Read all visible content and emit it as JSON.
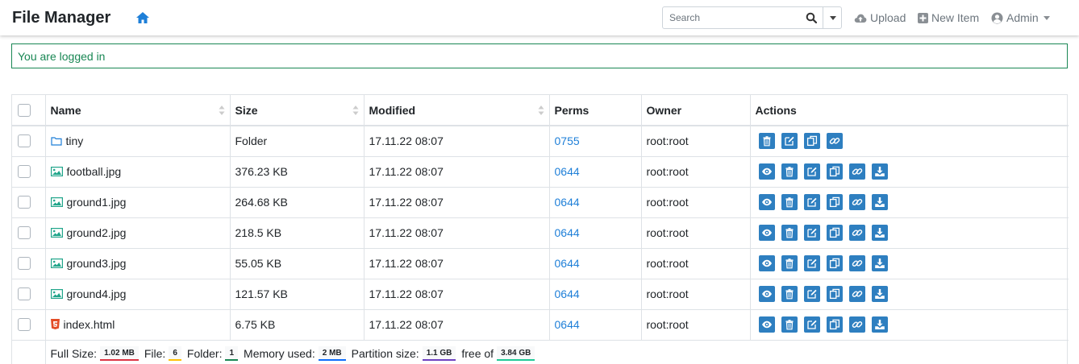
{
  "header": {
    "title": "File Manager",
    "search_placeholder": "Search",
    "upload_label": "Upload",
    "new_item_label": "New Item",
    "user_label": "Admin"
  },
  "alert": {
    "message": "You are logged in"
  },
  "table": {
    "columns": [
      "Name",
      "Size",
      "Modified",
      "Perms",
      "Owner",
      "Actions"
    ],
    "rows": [
      {
        "name": "tiny",
        "size": "Folder",
        "modified": "17.11.22 08:07",
        "perms": "0755",
        "owner": "root:root",
        "type": "folder"
      },
      {
        "name": "football.jpg",
        "size": "376.23 KB",
        "modified": "17.11.22 08:07",
        "perms": "0644",
        "owner": "root:root",
        "type": "image"
      },
      {
        "name": "ground1.jpg",
        "size": "264.68 KB",
        "modified": "17.11.22 08:07",
        "perms": "0644",
        "owner": "root:root",
        "type": "image"
      },
      {
        "name": "ground2.jpg",
        "size": "218.5 KB",
        "modified": "17.11.22 08:07",
        "perms": "0644",
        "owner": "root:root",
        "type": "image"
      },
      {
        "name": "ground3.jpg",
        "size": "55.05 KB",
        "modified": "17.11.22 08:07",
        "perms": "0644",
        "owner": "root:root",
        "type": "image"
      },
      {
        "name": "ground4.jpg",
        "size": "121.57 KB",
        "modified": "17.11.22 08:07",
        "perms": "0644",
        "owner": "root:root",
        "type": "image"
      },
      {
        "name": "index.html",
        "size": "6.75 KB",
        "modified": "17.11.22 08:07",
        "perms": "0644",
        "owner": "root:root",
        "type": "html"
      }
    ]
  },
  "footer": {
    "full_size_label": "Full Size:",
    "full_size_value": "1.02 MB",
    "file_label": "File:",
    "file_value": "6",
    "folder_label": "Folder:",
    "folder_value": "1",
    "memory_label": "Memory used:",
    "memory_value": "2 MB",
    "partition_label": "Partition size:",
    "partition_value": "1.1 GB",
    "free_label": "free of",
    "free_value": "3.84 GB"
  },
  "colors": {
    "accent": "#1e7fd8",
    "action_button": "#2e7fc0",
    "alert_green": "#198754",
    "image_icon": "#20a58a",
    "html_icon": "#e34c26",
    "badge_full_size": "#dc3545",
    "badge_file": "#ffc107",
    "badge_folder": "#198754",
    "badge_memory": "#0d6efd",
    "badge_partition": "#6f42c1",
    "badge_free": "#20c997"
  },
  "icons": {
    "home": "home-icon",
    "search": "search-icon",
    "upload": "cloud-upload-icon",
    "new_item": "plus-square-icon",
    "user": "user-circle-icon",
    "folder": "folder-icon",
    "image": "image-icon",
    "html": "html5-icon",
    "actions": [
      "eye-icon",
      "trash-icon",
      "edit-icon",
      "copy-icon",
      "link-icon",
      "download-icon"
    ]
  }
}
